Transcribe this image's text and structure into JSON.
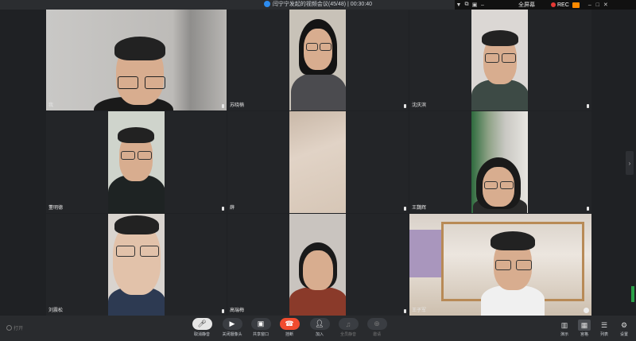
{
  "window": {
    "title": "闫宁宁发起的视频会议(45/48) | 00:30:40",
    "fullscreen_label": "全屏幕",
    "rec_label": "REC"
  },
  "participants": [
    {
      "name": "我"
    },
    {
      "name": "苏晓楠"
    },
    {
      "name": "沈庆滨"
    },
    {
      "name": "董明德"
    },
    {
      "name": "薛"
    },
    {
      "name": "王魏辉"
    },
    {
      "name": "刘震松"
    },
    {
      "name": "高瑞梅"
    },
    {
      "name": "王子军"
    }
  ],
  "toolbar": {
    "buttons": [
      {
        "label": "取消静音"
      },
      {
        "label": "关闭摄像头"
      },
      {
        "label": "共享窗口"
      },
      {
        "label": "挂断"
      },
      {
        "label": "加入"
      },
      {
        "label": "全员静音"
      },
      {
        "label": "邀请"
      }
    ],
    "layout": [
      {
        "label": "演示"
      },
      {
        "label": "宫格"
      },
      {
        "label": "列表"
      },
      {
        "label": "设置"
      }
    ],
    "left_label": "打开"
  },
  "colors": {
    "hangup": "#f04c2f",
    "accent": "#2d8cf0",
    "record": "#e53935"
  }
}
